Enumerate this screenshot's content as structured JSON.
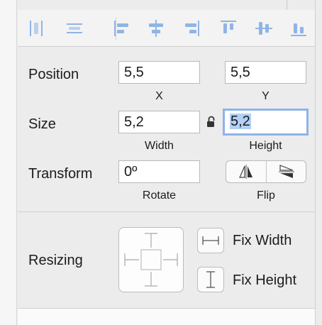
{
  "alignment_toolbar": {
    "buttons": [
      {
        "name": "distribute-horizontal-icon"
      },
      {
        "name": "distribute-vertical-icon"
      },
      {
        "name": "align-left-icon"
      },
      {
        "name": "align-horizontal-center-icon"
      },
      {
        "name": "align-right-icon"
      },
      {
        "name": "align-top-icon"
      },
      {
        "name": "align-vertical-center-icon"
      },
      {
        "name": "align-bottom-icon"
      }
    ],
    "icon_color": "#8fb5e6"
  },
  "position": {
    "label": "Position",
    "x_value": "5,5",
    "x_caption": "X",
    "y_value": "5,5",
    "y_caption": "Y"
  },
  "size": {
    "label": "Size",
    "width_value": "5,2",
    "width_caption": "Width",
    "height_value": "5,2",
    "height_caption": "Height",
    "lock_icon": "unlocked-padlock-icon"
  },
  "transform": {
    "label": "Transform",
    "rotate_value": "0º",
    "rotate_caption": "Rotate",
    "flip_caption": "Flip",
    "flip_icons": [
      "flip-horizontal-icon",
      "flip-vertical-icon"
    ]
  },
  "resizing": {
    "label": "Resizing",
    "fix_width_label": "Fix Width",
    "fix_height_label": "Fix Height"
  },
  "colors": {
    "focus_ring": "#8cb4e8",
    "selection": "#b3d0f6"
  }
}
